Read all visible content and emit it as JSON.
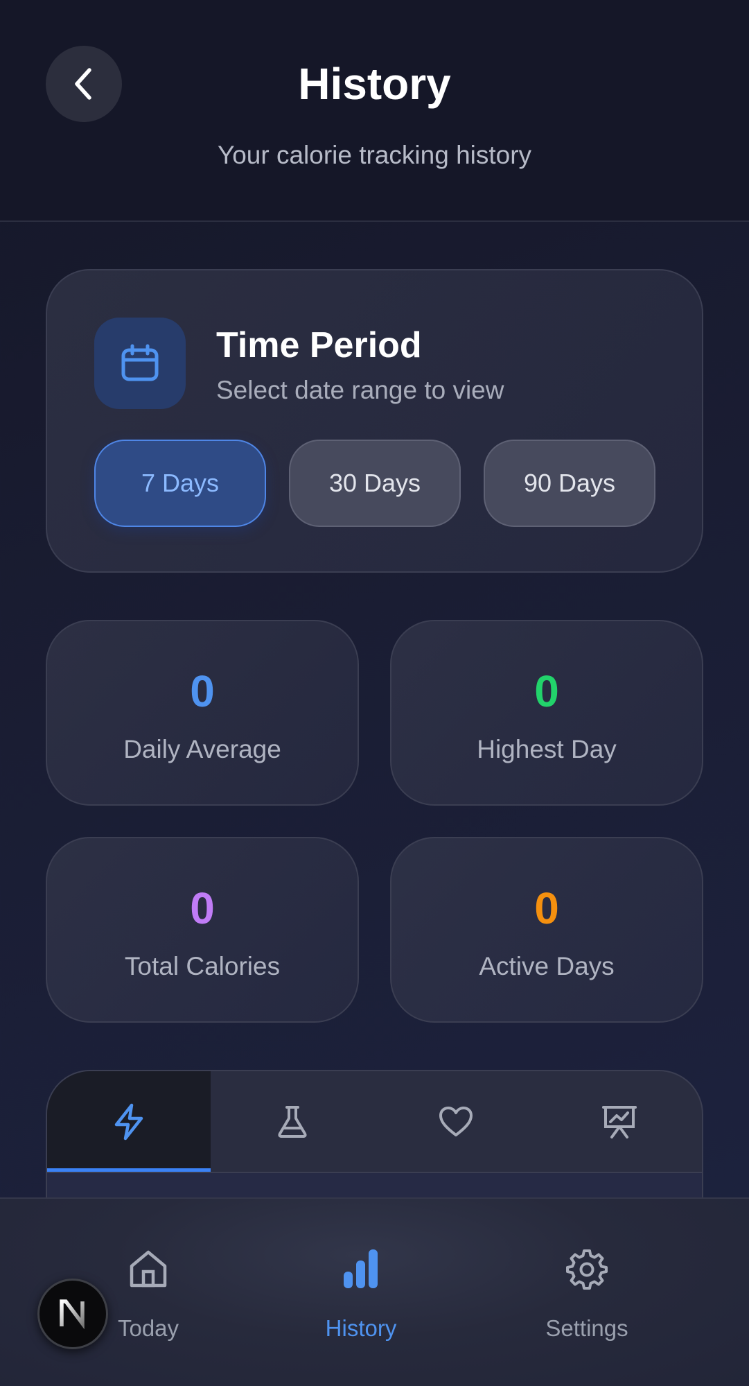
{
  "header": {
    "title": "History",
    "subtitle": "Your calorie tracking history",
    "back_icon": "chevron-left-icon"
  },
  "time_period": {
    "icon": "calendar-icon",
    "title": "Time Period",
    "subtitle": "Select date range to view",
    "options": [
      {
        "label": "7 Days",
        "selected": true
      },
      {
        "label": "30 Days",
        "selected": false
      },
      {
        "label": "90 Days",
        "selected": false
      }
    ]
  },
  "stats": [
    {
      "value": "0",
      "label": "Daily Average",
      "color": "#4f93f0"
    },
    {
      "value": "0",
      "label": "Highest Day",
      "color": "#22d36b"
    },
    {
      "value": "0",
      "label": "Total Calories",
      "color": "#c07cf6"
    },
    {
      "value": "0",
      "label": "Active Days",
      "color": "#f5900f"
    }
  ],
  "chart_tabs": [
    {
      "icon": "lightning-icon",
      "selected": true
    },
    {
      "icon": "flask-icon",
      "selected": false
    },
    {
      "icon": "heart-icon",
      "selected": false
    },
    {
      "icon": "presentation-chart-icon",
      "selected": false
    }
  ],
  "bottom_nav": [
    {
      "label": "Today",
      "icon": "home-icon",
      "selected": false
    },
    {
      "label": "History",
      "icon": "bar-chart-icon",
      "selected": true
    },
    {
      "label": "Settings",
      "icon": "gear-icon",
      "selected": false
    }
  ],
  "colors": {
    "accent": "#3b82f6",
    "active_tab_text": "#4f93f0"
  },
  "badge": {
    "letter": "N"
  }
}
